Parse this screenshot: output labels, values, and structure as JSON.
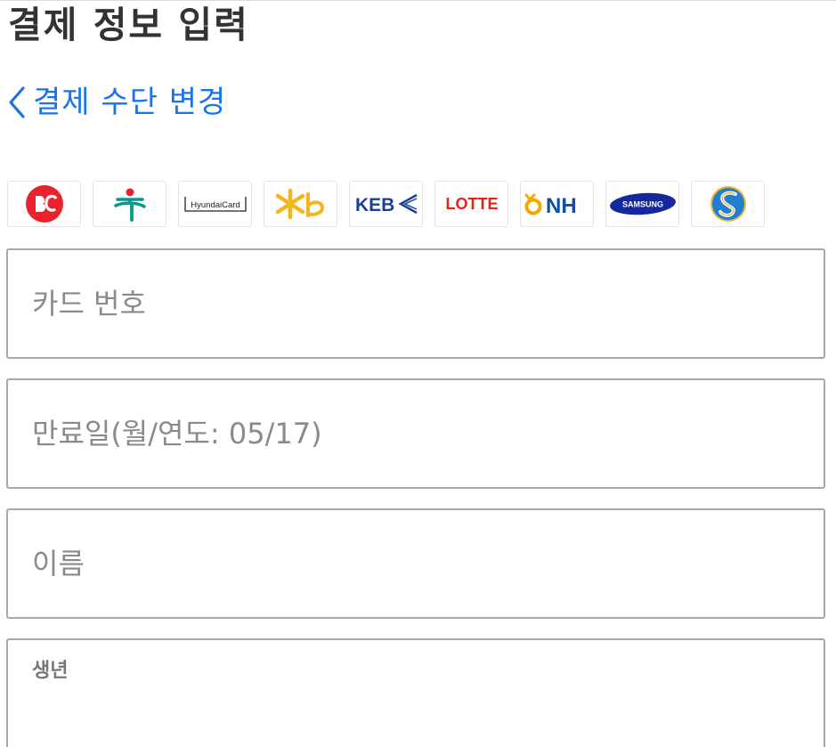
{
  "header": {
    "title": "결제 정보 입력"
  },
  "back": {
    "label": "결제 수단 변경",
    "icon": "chevron-left-icon"
  },
  "cards": {
    "hyundai": "HyundaiCard",
    "keb": "KEB",
    "lotte": "LOTTE",
    "nh": "NH",
    "samsung": "SAMSUNG"
  },
  "form": {
    "card_number_placeholder": "카드 번호",
    "expiry_placeholder": "만료일(월/연도: 05/17)",
    "name_placeholder": "이름",
    "birth_label": "생년"
  },
  "colors": {
    "link": "#1a73e8",
    "border": "#a7a7a7",
    "title": "#333333"
  }
}
